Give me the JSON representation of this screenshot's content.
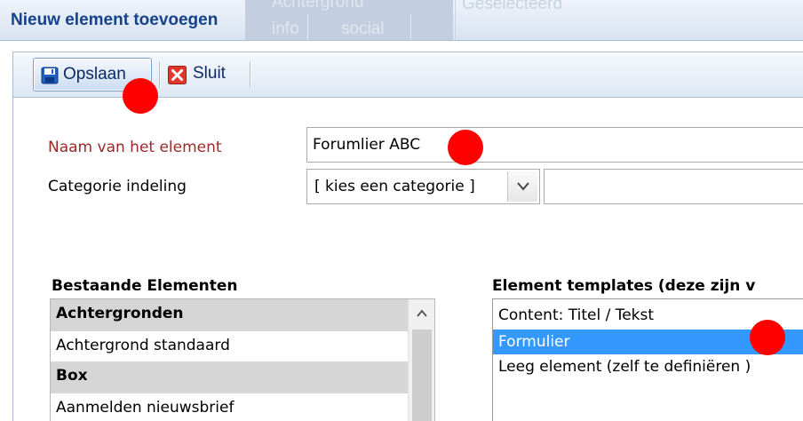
{
  "background_ghost": {
    "tab_text_top": "Achtergrond",
    "tab_text_left": "info",
    "tab_text_right": "social",
    "right_text": "Geselecteerd"
  },
  "dialog": {
    "title": "Nieuw element toevoegen"
  },
  "toolbar": {
    "save_label": "Opslaan",
    "close_label": "Sluit"
  },
  "form": {
    "name_label": "Naam van het element",
    "name_value": "Forumlier ABC",
    "category_label": "Categorie indeling",
    "category_value": "[ kies een categorie ]",
    "category_extra_value": ""
  },
  "existing_elements": {
    "heading": "Bestaande Elementen",
    "rows": [
      {
        "label": "Achtergronden",
        "type": "group"
      },
      {
        "label": "Achtergrond standaard",
        "type": "item"
      },
      {
        "label": "Box",
        "type": "group"
      },
      {
        "label": "Aanmelden nieuwsbrief",
        "type": "item"
      }
    ]
  },
  "templates": {
    "heading": "Element templates (deze zijn v",
    "items": [
      {
        "label": "Content: Titel / Tekst",
        "selected": false
      },
      {
        "label": "Formulier",
        "selected": true
      },
      {
        "label": "Leeg element (zelf te definiëren )",
        "selected": false
      }
    ]
  },
  "colors": {
    "title_blue": "#15428b",
    "label_red": "#9b2a2a",
    "selection_blue": "#3399ff",
    "marker_red": "#ff0000",
    "group_gray": "#d6d6d6"
  },
  "icons": {
    "save": "floppy-disk-icon",
    "close": "red-x-icon",
    "dropdown": "chevron-down-icon",
    "scroll_up": "chevron-up-icon"
  }
}
